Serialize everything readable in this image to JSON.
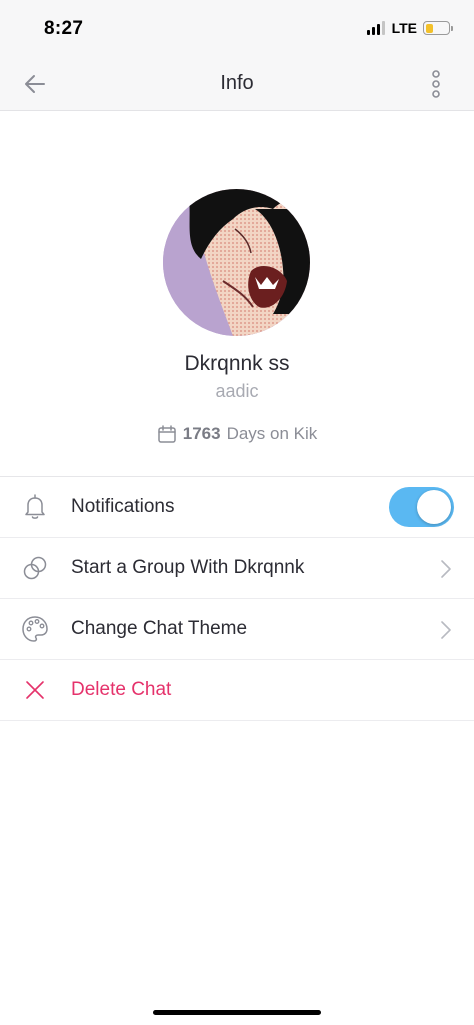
{
  "status_bar": {
    "time": "8:27",
    "network": "LTE",
    "battery_level": 0.34
  },
  "nav": {
    "title": "Info",
    "back_icon": "arrow-left-icon",
    "more_icon": "vertical-dots-icon"
  },
  "profile": {
    "display_name": "Dkrqnnk ss",
    "username": "aadic",
    "days_count": "1763",
    "days_suffix": "Days on Kik",
    "avatar_bg": "#b9a3cf"
  },
  "menu": {
    "items": [
      {
        "label": "Notifications",
        "icon": "bell-icon",
        "toggle_on": true
      },
      {
        "label": "Start a Group With Dkrqnnk",
        "icon": "group-circles-icon"
      },
      {
        "label": "Change Chat Theme",
        "icon": "palette-icon"
      },
      {
        "label": "Delete Chat",
        "icon": "close-icon"
      }
    ]
  },
  "colors": {
    "accent_toggle": "#5ab8f2",
    "danger": "#e5326b",
    "text_primary": "#2c2c34",
    "text_secondary": "#a8aab2"
  }
}
